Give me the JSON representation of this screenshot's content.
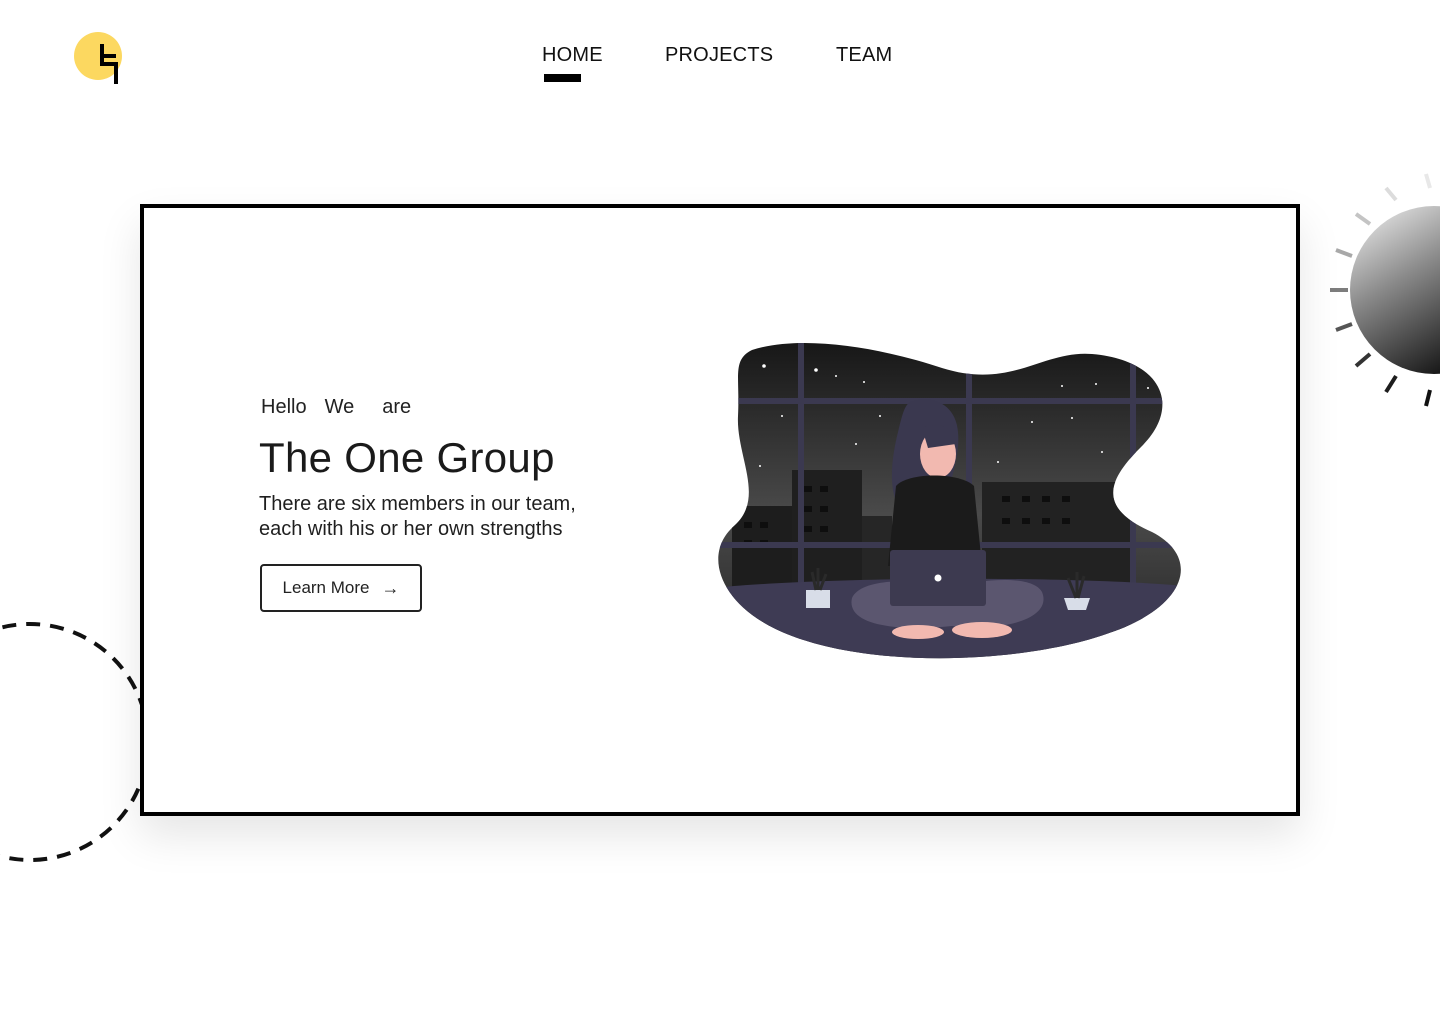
{
  "nav": {
    "items": [
      {
        "label": "HOME",
        "active": true
      },
      {
        "label": "PROJECTS",
        "active": false
      },
      {
        "label": "TEAM",
        "active": false
      }
    ]
  },
  "hero": {
    "greeting": [
      "Hello",
      "We",
      "are"
    ],
    "title": "The One Group",
    "description_line1": "There are six members in our team,",
    "description_line2": "each with his or her own strengths",
    "button_label": "Learn More",
    "button_icon": "arrow-right-icon"
  },
  "colors": {
    "logo_yellow": "#FCD860",
    "accent_black": "#000000",
    "night_sky": "#2B2B2B",
    "floor_purple": "#3E3B54"
  }
}
